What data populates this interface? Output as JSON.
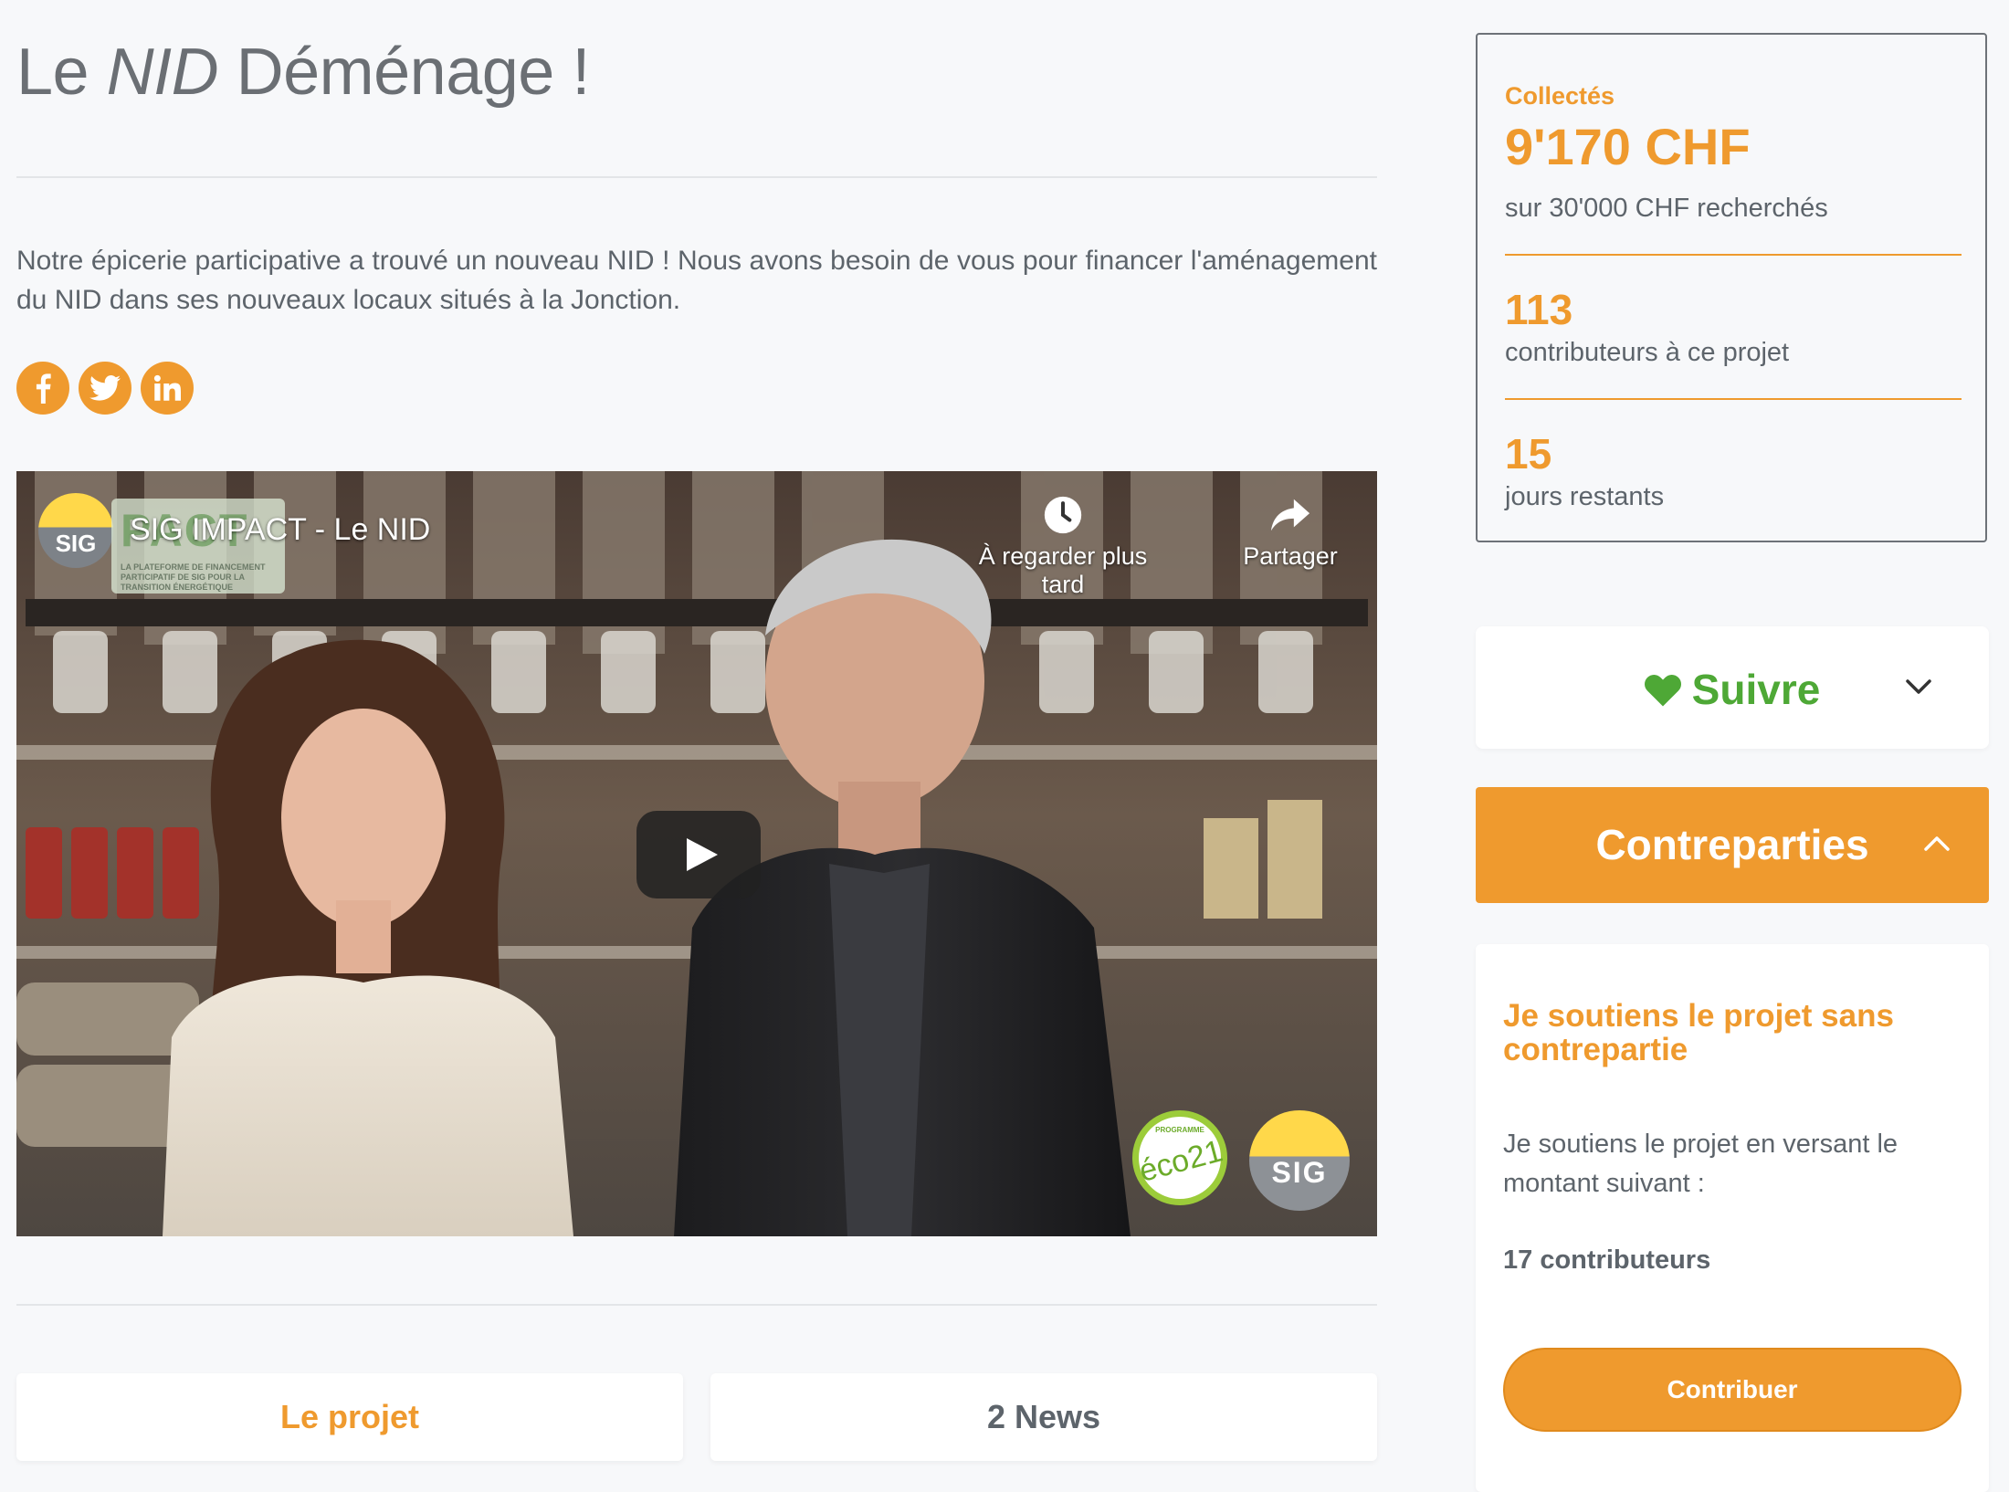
{
  "project": {
    "title_prefix": "Le ",
    "title_italic": "NID",
    "title_suffix": " Déménage !",
    "description": "Notre épicerie participative a trouvé un nouveau NID ! Nous avons besoin de vous pour financer l'aménagement du NID dans ses nouveaux locaux situés à la Jonction."
  },
  "social": [
    {
      "name": "facebook",
      "icon": "facebook-icon"
    },
    {
      "name": "twitter",
      "icon": "twitter-icon"
    },
    {
      "name": "linkedin",
      "icon": "linkedin-icon"
    }
  ],
  "video": {
    "title": "SIG IMPACT - Le NID",
    "channel_logo": "SIG",
    "impact_banner": "PACT",
    "impact_tagline": "LA PLATEFORME DE FINANCEMENT PARTICIPATIF DE SIG POUR LA TRANSITION ÉNERGÉTIQUE",
    "watch_later": "À regarder plus tard",
    "share": "Partager",
    "eco_badge": "éco21",
    "eco_badge_small": "PROGRAMME",
    "sig_badge": "SIG"
  },
  "tabs": [
    {
      "label": "Le projet",
      "active": true
    },
    {
      "label": "2 News",
      "active": false
    }
  ],
  "stats": {
    "collected_label": "Collectés",
    "collected_amount": "9'170 CHF",
    "goal": "sur 30'000 CHF recherchés",
    "contributors_count": "113",
    "contributors_label": "contributeurs à ce projet",
    "days_count": "15",
    "days_label": "jours restants"
  },
  "follow": {
    "label": "Suivre",
    "icon": "heart-icon",
    "toggle_icon": "chevron-down-icon"
  },
  "rewards": {
    "label": "Contreparties",
    "toggle_icon": "chevron-up-icon"
  },
  "reward_card": {
    "title": "Je soutiens le projet sans contrepartie",
    "text": "Je soutiens le projet en versant le montant suivant :",
    "contributors": "17 contributeurs",
    "button": "Contribuer"
  },
  "colors": {
    "accent": "#ef9a2e",
    "follow_green": "#4ea836",
    "text": "#5d646b"
  }
}
